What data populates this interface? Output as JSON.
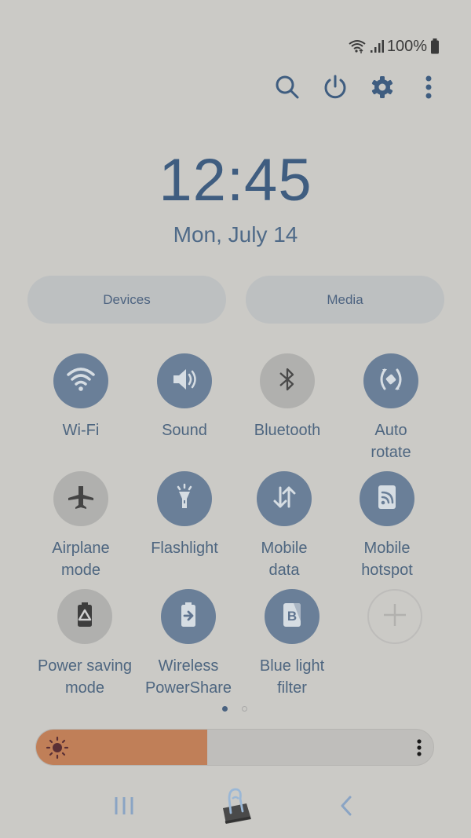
{
  "status_bar": {
    "wifi_icon": "wifi-icon",
    "signal_icon": "signal-icon",
    "battery_percent": "100%",
    "battery_icon": "battery-full-icon"
  },
  "toolbar": {
    "items": [
      {
        "name": "search",
        "icon": "search-icon"
      },
      {
        "name": "power",
        "icon": "power-icon"
      },
      {
        "name": "settings",
        "icon": "gear-icon"
      },
      {
        "name": "more",
        "icon": "more-vertical-icon"
      }
    ]
  },
  "clock": {
    "time": "12:45",
    "date": "Mon, July 14"
  },
  "pills": {
    "devices": "Devices",
    "media": "Media"
  },
  "tiles": [
    {
      "label": "Wi-Fi",
      "icon": "wifi-icon",
      "state": "on"
    },
    {
      "label": "Sound",
      "icon": "speaker-icon",
      "state": "on"
    },
    {
      "label": "Bluetooth",
      "icon": "bluetooth-icon",
      "state": "off"
    },
    {
      "label": "Auto\nrotate",
      "icon": "auto-rotate-icon",
      "state": "on"
    },
    {
      "label": "Airplane\nmode",
      "icon": "airplane-icon",
      "state": "off"
    },
    {
      "label": "Flashlight",
      "icon": "flashlight-icon",
      "state": "on"
    },
    {
      "label": "Mobile\ndata",
      "icon": "mobile-data-icon",
      "state": "on"
    },
    {
      "label": "Mobile\nhotspot",
      "icon": "hotspot-icon",
      "state": "on"
    },
    {
      "label": "Power saving\nmode",
      "icon": "power-saving-icon",
      "state": "off"
    },
    {
      "label": "Wireless\nPowerShare",
      "icon": "wireless-powershare-icon",
      "state": "on"
    },
    {
      "label": "Blue light\nfilter",
      "icon": "blue-light-filter-icon",
      "state": "on"
    },
    {
      "label": "",
      "icon": "add-icon",
      "state": "add"
    }
  ],
  "pagination": {
    "current": 1,
    "total": 2
  },
  "brightness": {
    "level_percent": 43,
    "icon": "sun-icon",
    "more_icon": "more-vertical-icon",
    "colors": {
      "fill": "#c07f58",
      "track": "#bfbebb"
    }
  },
  "navbar": {
    "recents_icon": "recents-icon",
    "home_icon": "binder-clip-icon",
    "back_icon": "back-chevron-icon"
  },
  "colors": {
    "background": "#cbcac6",
    "tile_on": "#6a7f98",
    "tile_off": "#b0b0ae",
    "accent_text": "#3f5d80"
  }
}
